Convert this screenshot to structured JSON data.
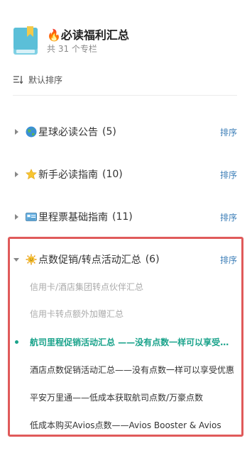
{
  "header": {
    "title": "🔥必读福利汇总",
    "subtitle": "共 31 个专栏"
  },
  "sort": {
    "label": "默认排序"
  },
  "sections": [
    {
      "emoji": "globe-icon",
      "title": "星球必读公告",
      "count": "(5)",
      "sort": "排序"
    },
    {
      "emoji": "star-icon",
      "title": "新手必读指南",
      "count": "(10)",
      "sort": "排序"
    },
    {
      "emoji": "card-icon",
      "title": "里程票基础指南",
      "count": "(11)",
      "sort": "排序"
    },
    {
      "emoji": "sun-icon",
      "title": "点数促销/转点活动汇总",
      "count": "(6)",
      "sort": "排序"
    }
  ],
  "articles": [
    {
      "title": "信用卡/酒店集团转点伙伴汇总",
      "state": "read"
    },
    {
      "title": "信用卡转点额外加赠汇总",
      "state": "read"
    },
    {
      "title": "航司里程促销活动汇总 ——没有点数一样可以享受优惠",
      "state": "active"
    },
    {
      "title": "酒店点数促销活动汇总——没有点数一样可以享受优惠",
      "state": "normal"
    },
    {
      "title": "平安万里通——低成本获取航司点数/万豪点数",
      "state": "normal"
    },
    {
      "title": "低成本购买Avios点数——Avios Booster & Avios",
      "state": "normal"
    }
  ],
  "colors": {
    "accent": "#1aa38b",
    "link": "#3e7fb8",
    "highlight": "#e05a5a"
  }
}
